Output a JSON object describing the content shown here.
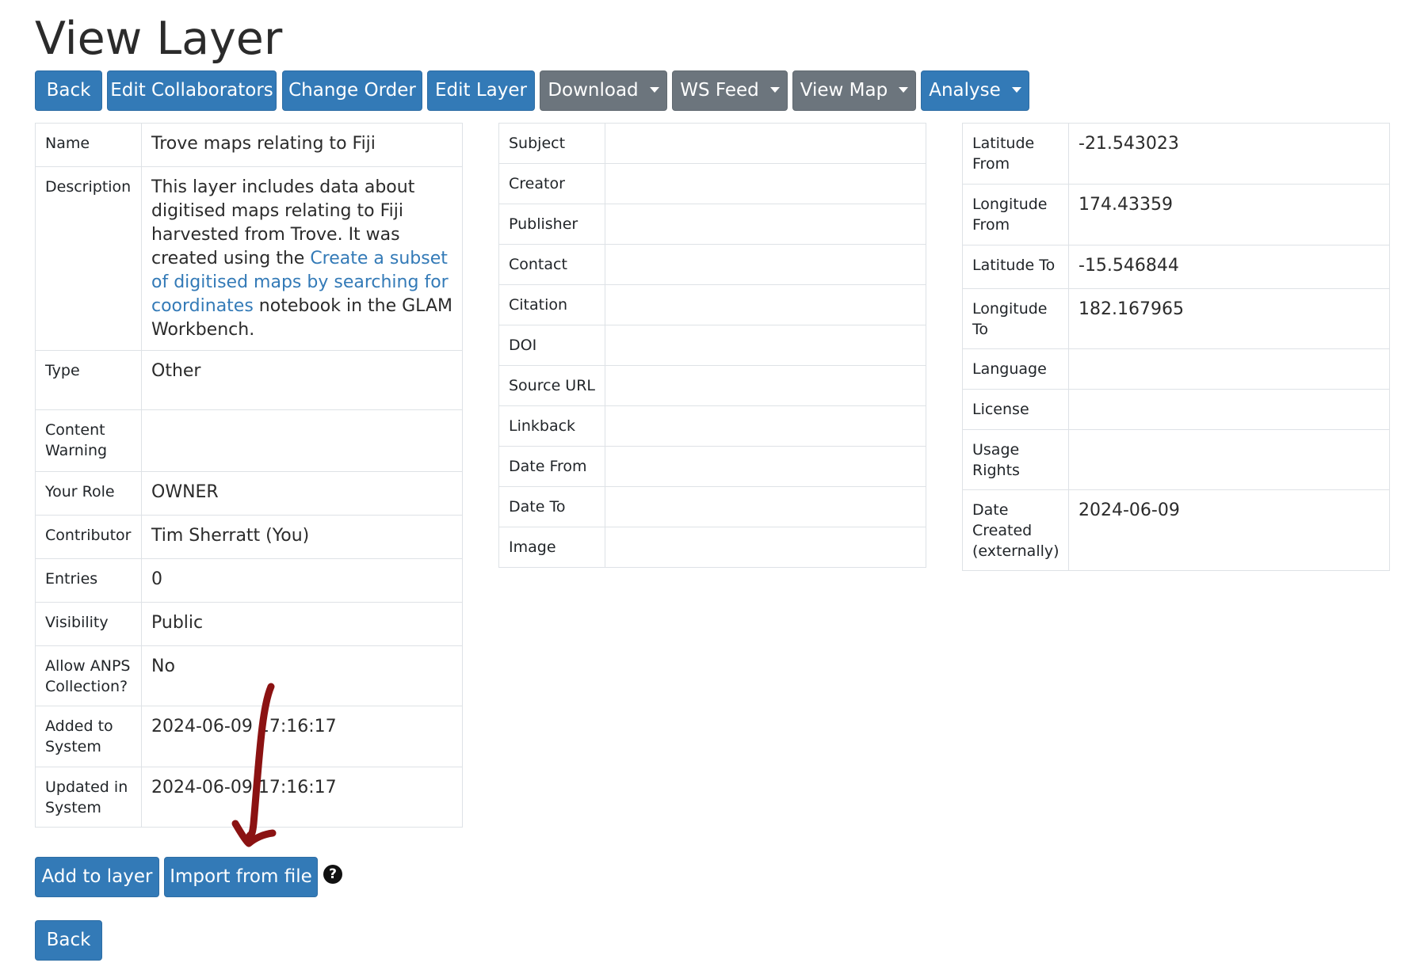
{
  "page": {
    "title": "View Layer"
  },
  "toolbar": {
    "back": "Back",
    "edit_collaborators": "Edit Collaborators",
    "change_order": "Change Order",
    "edit_layer": "Edit Layer",
    "download": "Download",
    "ws_feed": "WS Feed",
    "view_map": "View Map",
    "analyse": "Analyse"
  },
  "details": {
    "name_label": "Name",
    "name_value": "Trove maps relating to Fiji",
    "description_label": "Description",
    "description_pre": "This layer includes data about digitised maps relating to Fiji harvested from Trove. It was created using the ",
    "description_link": "Create a subset of digitised maps by searching for coordinates",
    "description_post": " notebook in the GLAM Workbench.",
    "type_label": "Type",
    "type_value": "Other",
    "content_warning_label": "Content Warning",
    "content_warning_value": "",
    "role_label": "Your Role",
    "role_value": "OWNER",
    "contributor_label": "Contributor",
    "contributor_value": "Tim Sherratt (You)",
    "entries_label": "Entries",
    "entries_value": "0",
    "visibility_label": "Visibility",
    "visibility_value": "Public",
    "anps_label": "Allow ANPS Collection?",
    "anps_value": "No",
    "added_label": "Added to System",
    "added_value": "2024-06-09 17:16:17",
    "updated_label": "Updated in System",
    "updated_value": "2024-06-09 17:16:17"
  },
  "metadata": {
    "subject_label": "Subject",
    "subject_value": "",
    "creator_label": "Creator",
    "creator_value": "",
    "publisher_label": "Publisher",
    "publisher_value": "",
    "contact_label": "Contact",
    "contact_value": "",
    "citation_label": "Citation",
    "citation_value": "",
    "doi_label": "DOI",
    "doi_value": "",
    "source_url_label": "Source URL",
    "source_url_value": "",
    "linkback_label": "Linkback",
    "linkback_value": "",
    "date_from_label": "Date From",
    "date_from_value": "",
    "date_to_label": "Date To",
    "date_to_value": "",
    "image_label": "Image",
    "image_value": ""
  },
  "extent": {
    "lat_from_label": "Latitude From",
    "lat_from_value": "-21.543023",
    "lon_from_label": "Longitude From",
    "lon_from_value": "174.43359",
    "lat_to_label": "Latitude To",
    "lat_to_value": "-15.546844",
    "lon_to_label": "Longitude To",
    "lon_to_value": "182.167965",
    "language_label": "Language",
    "language_value": "",
    "license_label": "License",
    "license_value": "",
    "usage_rights_label": "Usage Rights",
    "usage_rights_value": "",
    "date_created_label": "Date Created (externally)",
    "date_created_value": "2024-06-09"
  },
  "actions": {
    "add_to_layer": "Add to layer",
    "import_from_file": "Import from file",
    "help_icon": "?",
    "back": "Back"
  },
  "annotation": {
    "icon": "arrow-icon",
    "color": "#8b1212"
  },
  "colors": {
    "primary": "#337ab7",
    "secondary": "#6c757d",
    "link": "#337ab7"
  }
}
